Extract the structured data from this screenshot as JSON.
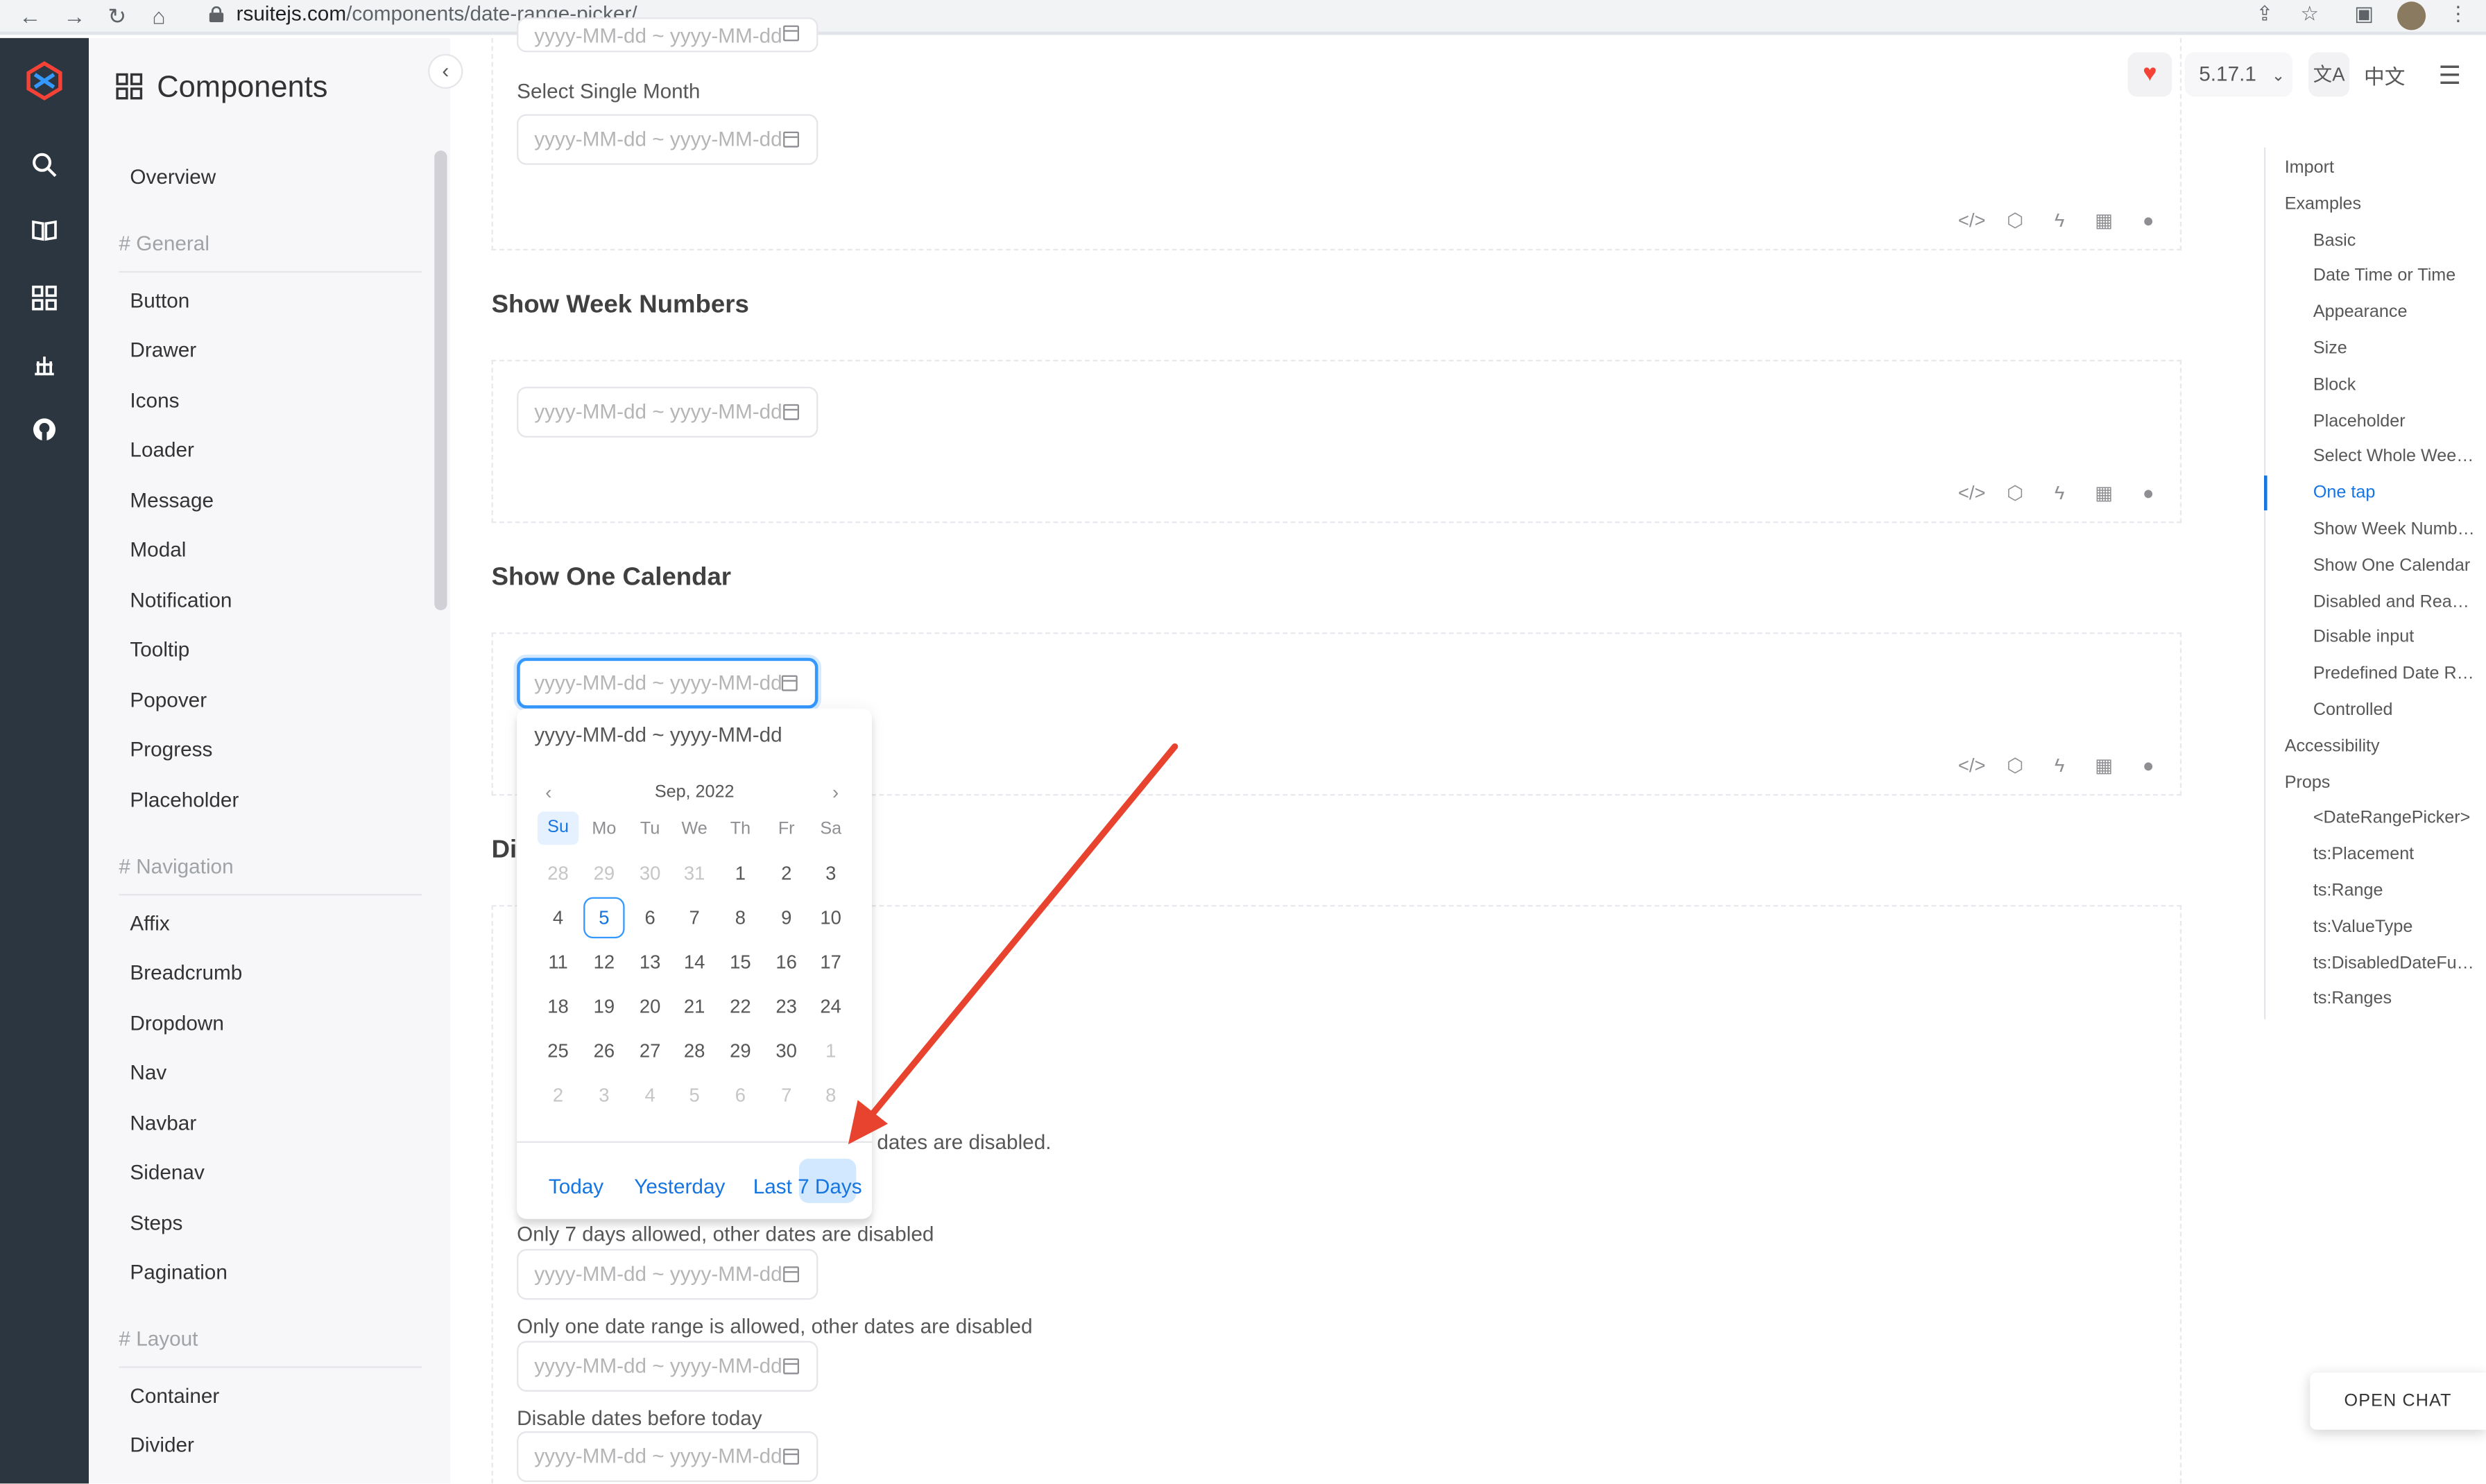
{
  "browser": {
    "url_host": "rsuitejs.com",
    "url_path": "/components/date-range-picker/"
  },
  "sidebar": {
    "title": "Components",
    "overview": "Overview",
    "groups": [
      {
        "label": "# General",
        "items": [
          "Button",
          "Drawer",
          "Icons",
          "Loader",
          "Message",
          "Modal",
          "Notification",
          "Tooltip",
          "Popover",
          "Progress",
          "Placeholder"
        ]
      },
      {
        "label": "# Navigation",
        "items": [
          "Affix",
          "Breadcrumb",
          "Dropdown",
          "Nav",
          "Navbar",
          "Sidenav",
          "Steps",
          "Pagination"
        ]
      },
      {
        "label": "# Layout",
        "items": [
          "Container",
          "Divider"
        ]
      }
    ]
  },
  "header": {
    "version": "5.17.1",
    "lang_icon": "translate-icon",
    "lang_label": "中文"
  },
  "main": {
    "placeholder": "yyyy-MM-dd ~ yyyy-MM-dd",
    "select_single_month": "Select Single Month",
    "show_week_numbers": "Show Week Numbers",
    "show_one_calendar": "Show One Calendar",
    "disabled_heading_partial": "Di",
    "partial_desc": "er dates are disabled.",
    "only_7_days": "Only 7 days allowed, other dates are disabled",
    "only_one_range": "Only one date range is allowed, other dates are disabled",
    "disable_before_today": "Disable dates before today"
  },
  "calendar": {
    "header_value": "yyyy-MM-dd ~ yyyy-MM-dd",
    "month": "Sep, 2022",
    "weekdays": [
      "Su",
      "Mo",
      "Tu",
      "We",
      "Th",
      "Fr",
      "Sa"
    ],
    "weeks": [
      [
        "28",
        "29",
        "30",
        "31",
        "1",
        "2",
        "3"
      ],
      [
        "4",
        "5",
        "6",
        "7",
        "8",
        "9",
        "10"
      ],
      [
        "11",
        "12",
        "13",
        "14",
        "15",
        "16",
        "17"
      ],
      [
        "18",
        "19",
        "20",
        "21",
        "22",
        "23",
        "24"
      ],
      [
        "25",
        "26",
        "27",
        "28",
        "29",
        "30",
        "1"
      ],
      [
        "2",
        "3",
        "4",
        "5",
        "6",
        "7",
        "8"
      ]
    ],
    "today": "5",
    "ranges": [
      "Today",
      "Yesterday",
      "Last 7 Days"
    ]
  },
  "toc": {
    "items": [
      {
        "label": "Import",
        "level": 0
      },
      {
        "label": "Examples",
        "level": 0
      },
      {
        "label": "Basic",
        "level": 1
      },
      {
        "label": "Date Time or Time",
        "level": 1
      },
      {
        "label": "Appearance",
        "level": 1
      },
      {
        "label": "Size",
        "level": 1
      },
      {
        "label": "Block",
        "level": 1
      },
      {
        "label": "Placeholder",
        "level": 1
      },
      {
        "label": "Select Whole Wee…",
        "level": 1
      },
      {
        "label": "One tap",
        "level": 1,
        "active": true
      },
      {
        "label": "Show Week Numb…",
        "level": 1
      },
      {
        "label": "Show One Calendar",
        "level": 1
      },
      {
        "label": "Disabled and Read…",
        "level": 1
      },
      {
        "label": "Disable input",
        "level": 1
      },
      {
        "label": "Predefined Date R…",
        "level": 1
      },
      {
        "label": "Controlled",
        "level": 1
      },
      {
        "label": "Accessibility",
        "level": 0
      },
      {
        "label": "Props",
        "level": 0
      },
      {
        "label": "<DateRangePicker>",
        "level": 1
      },
      {
        "label": "ts:Placement",
        "level": 1
      },
      {
        "label": "ts:Range",
        "level": 1
      },
      {
        "label": "ts:ValueType",
        "level": 1
      },
      {
        "label": "ts:DisabledDateFu…",
        "level": 1
      },
      {
        "label": "ts:Ranges",
        "level": 1
      }
    ]
  },
  "chat": {
    "label": "OPEN CHAT"
  },
  "colors": {
    "accent": "#1675e0",
    "rail": "#2b3640",
    "arrow": "#e8432e"
  }
}
